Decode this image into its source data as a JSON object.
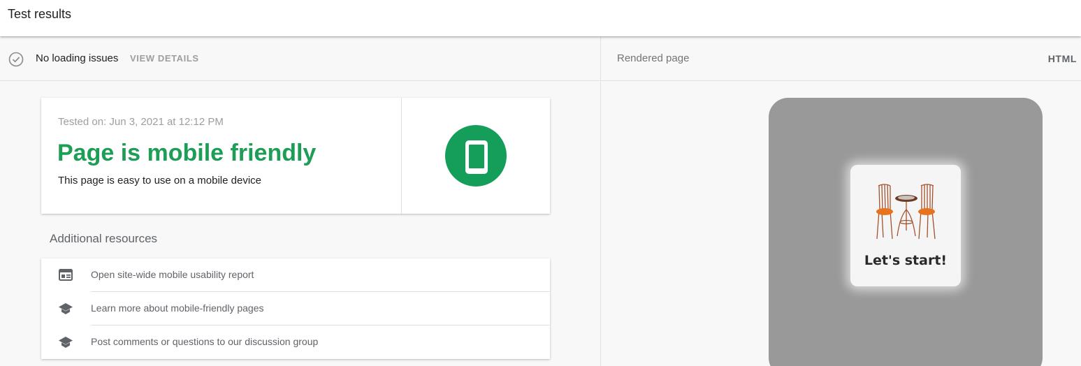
{
  "header": {
    "title": "Test results"
  },
  "status": {
    "text": "No loading issues",
    "details_label": "VIEW DETAILS",
    "icon": "check-circle-icon"
  },
  "result": {
    "tested_on": "Tested on: Jun 3, 2021 at 12:12 PM",
    "verdict": "Page is mobile friendly",
    "description": "This page is easy to use on a mobile device",
    "badge_icon": "smartphone-icon",
    "accent_color": "#1e9d57"
  },
  "resources": {
    "heading": "Additional resources",
    "items": [
      {
        "label": "Open site-wide mobile usability report",
        "icon": "web-report-icon"
      },
      {
        "label": "Learn more about mobile-friendly pages",
        "icon": "graduation-cap-icon"
      },
      {
        "label": "Post comments or questions to our discussion group",
        "icon": "graduation-cap-icon"
      }
    ]
  },
  "rendered": {
    "label": "Rendered page",
    "tab_label": "HTML",
    "preview_title": "Let's start!",
    "preview_image": "bistro-chairs-image"
  }
}
